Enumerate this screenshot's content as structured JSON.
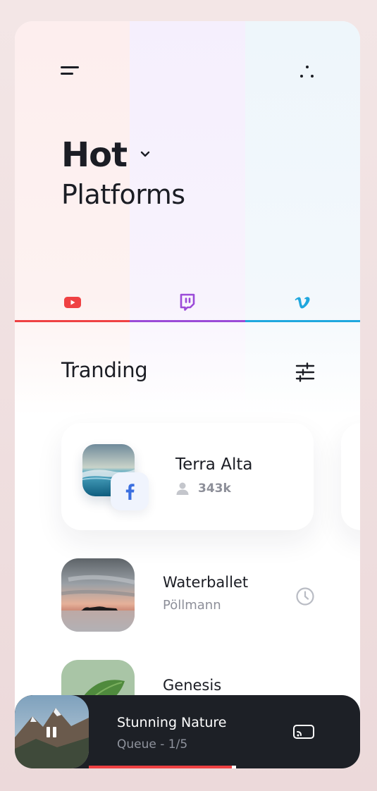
{
  "header": {
    "title_main": "Hot",
    "title_sub": "Platforms",
    "menu_icon": "menu-icon",
    "more_icon": "more-dots-icon"
  },
  "platforms": [
    {
      "name": "youtube",
      "icon": "youtube-icon",
      "color": "#ef4143"
    },
    {
      "name": "twitch",
      "icon": "twitch-icon",
      "color": "#9b4ad8"
    },
    {
      "name": "vimeo",
      "icon": "vimeo-icon",
      "color": "#1fa7de"
    }
  ],
  "section": {
    "title": "Tranding",
    "filter_icon": "sliders-icon"
  },
  "featured": {
    "name": "Terra Alta",
    "count": "343k",
    "badge_icon": "facebook-icon"
  },
  "list": [
    {
      "title": "Waterballet",
      "subtitle": "Pöllmann",
      "action_icon": "clock-icon"
    },
    {
      "title": "Genesis"
    }
  ],
  "player": {
    "title": "Stunning Nature",
    "subtitle": "Queue - 1/5",
    "cast_icon": "cast-icon",
    "progress": 0.62
  }
}
